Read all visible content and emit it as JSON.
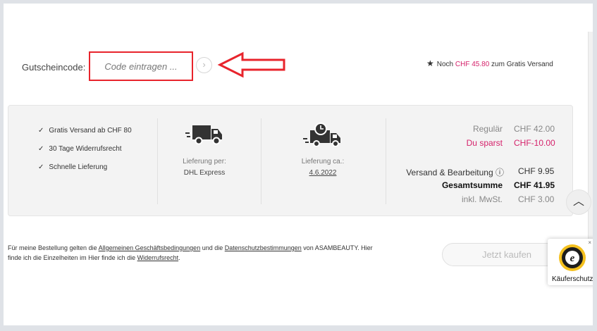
{
  "coupon": {
    "label": "Gutscheincode:",
    "placeholder": "Code eintragen ...",
    "submit_glyph": "›"
  },
  "free_shipping": {
    "prefix": "Noch",
    "amount": "CHF 45.80",
    "suffix": "zum Gratis Versand"
  },
  "benefits": [
    "Gratis Versand ab CHF 80",
    "30 Tage Widerrufsrecht",
    "Schnelle Lieferung"
  ],
  "delivery": {
    "carrier_label": "Lieferung per:",
    "carrier_value": "DHL Express",
    "date_label": "Lieferung ca.:",
    "date_value": "4.6.2022"
  },
  "totals": {
    "regular_label": "Regulär",
    "regular_value": "CHF 42.00",
    "savings_label": "Du sparst",
    "savings_value": "CHF-10.00",
    "shipping_label": "Versand & Bearbeitung",
    "shipping_value": "CHF 9.95",
    "total_label": "Gesamtsumme",
    "total_value": "CHF 41.95",
    "vat_label": "inkl. MwSt.",
    "vat_value": "CHF 3.00"
  },
  "legal": {
    "t1": "Für meine Bestellung gelten die ",
    "link_agb": "Allgemeinen Geschäftsbedingungen",
    "t2": " und die ",
    "link_privacy": "Datenschutzbestimmungen",
    "t3": " von ASAMBEAUTY. Hier finde ich die Einzelheiten im Hier finde ich die ",
    "link_withdrawal": "Widerrufsrecht",
    "t4": "."
  },
  "buy_button": "Jetzt kaufen",
  "trusted_badge": {
    "label": "Käuferschutz",
    "close": "×"
  },
  "scroll_top_glyph": "︿",
  "colors": {
    "accent": "#d5226b",
    "highlight": "#e8242c"
  }
}
